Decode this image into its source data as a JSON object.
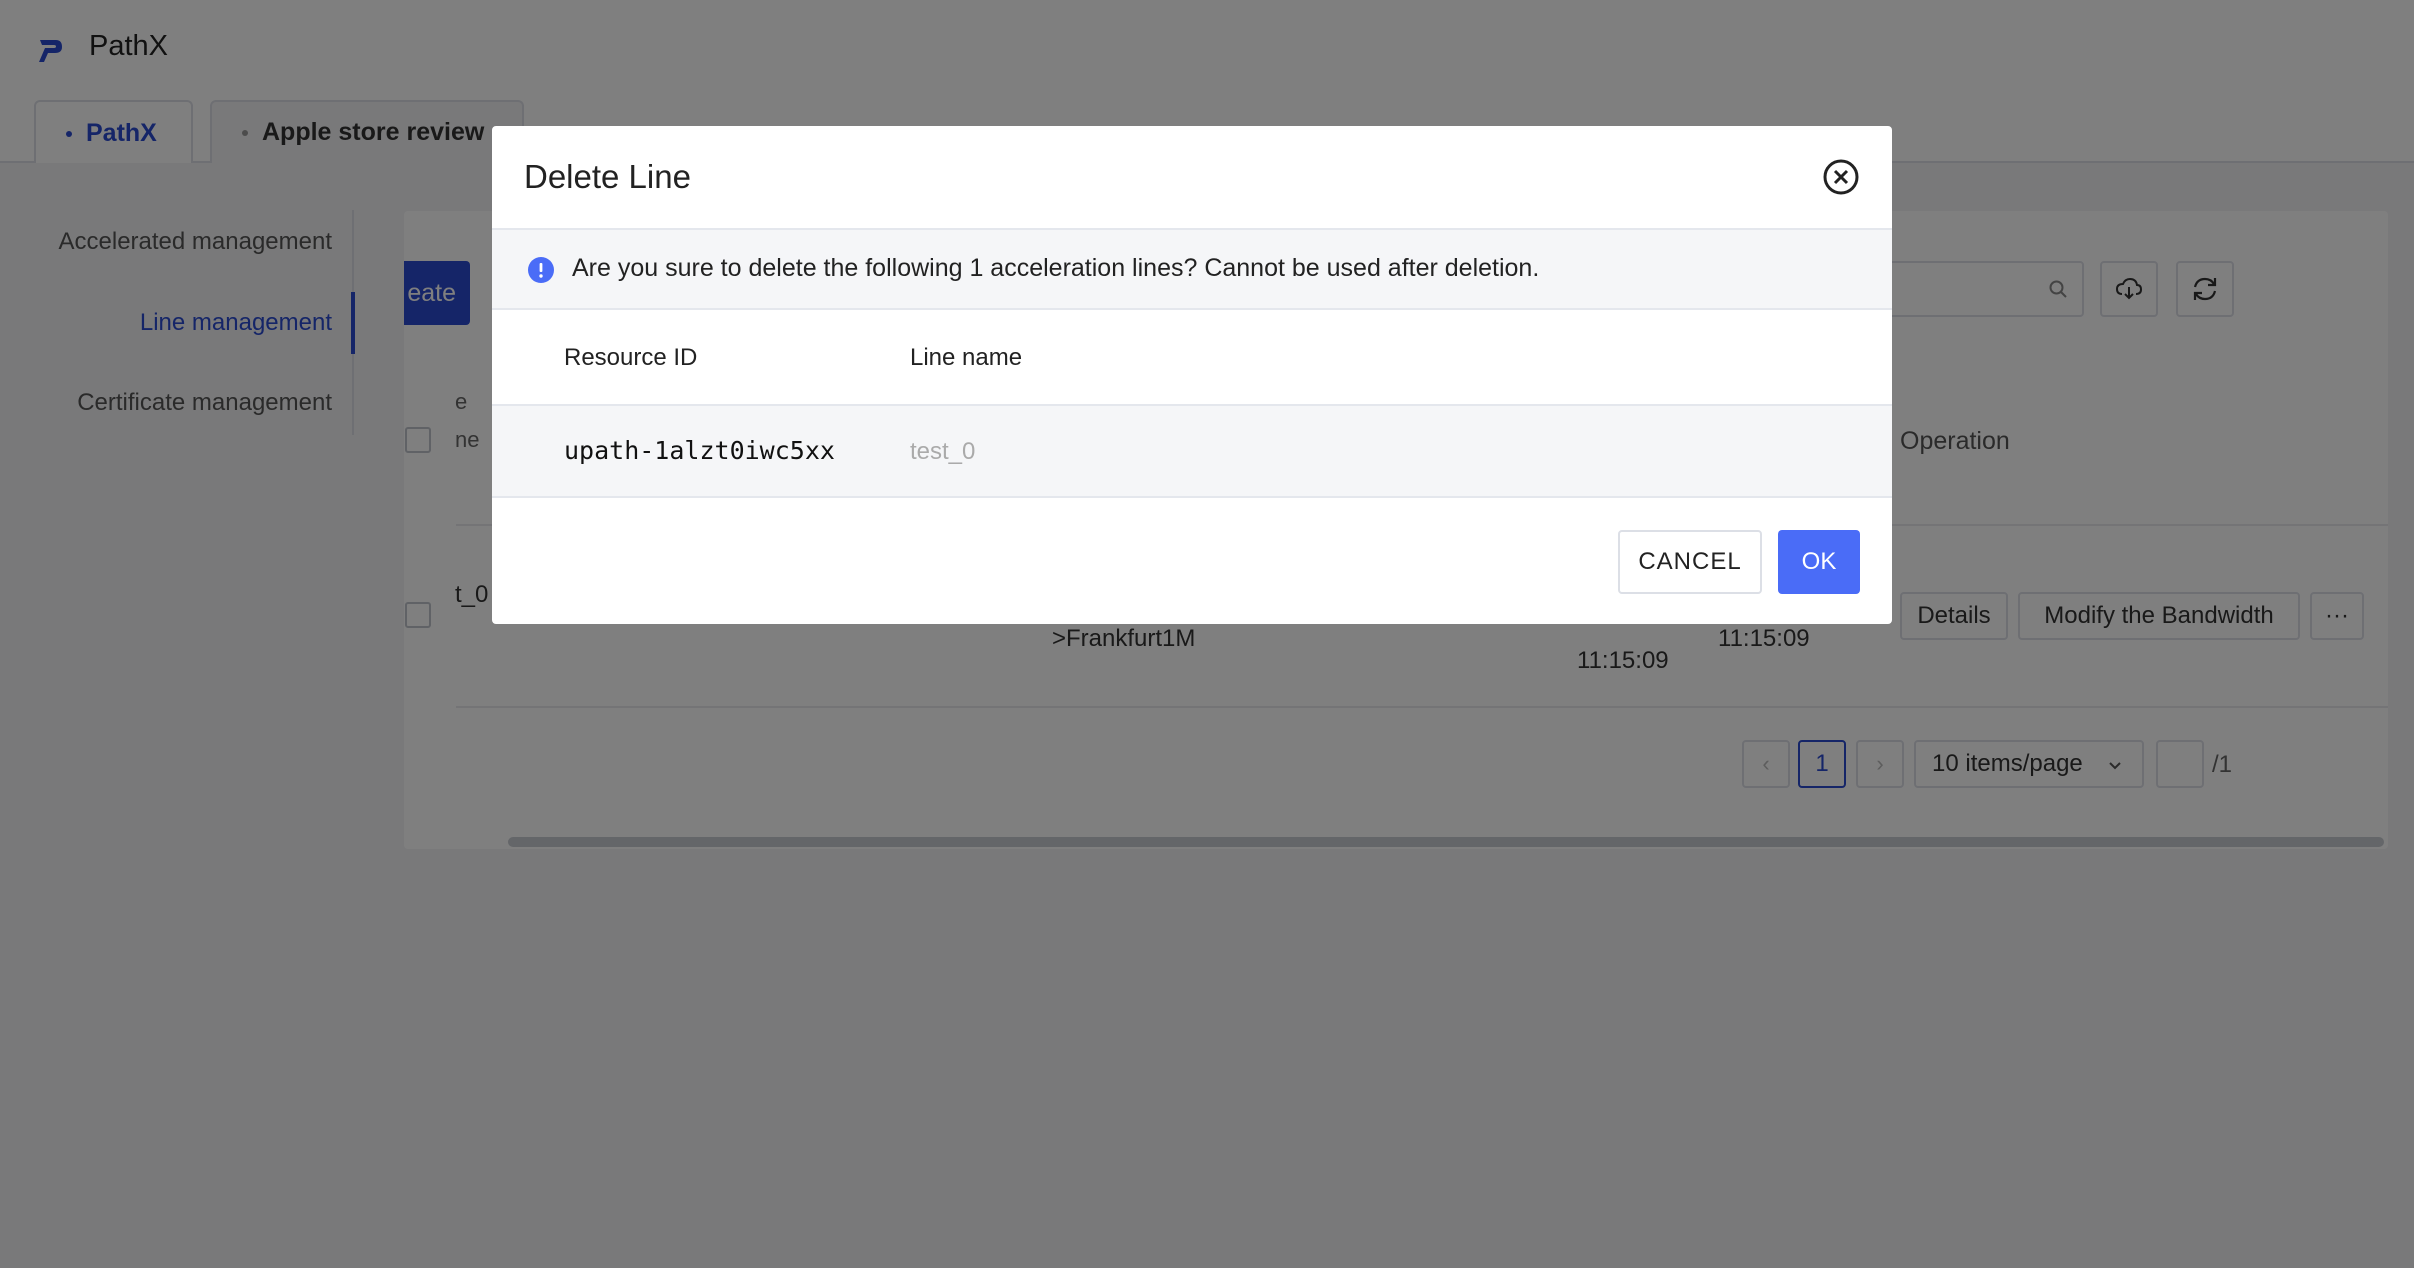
{
  "app": {
    "title": "PathX"
  },
  "tabs": [
    {
      "label": "PathX",
      "active": true
    },
    {
      "label": "Apple store review",
      "active": false
    }
  ],
  "sidebar": {
    "items": [
      {
        "label": "Accelerated management",
        "active": false
      },
      {
        "label": "Line management",
        "active": true
      },
      {
        "label": "Certificate management",
        "active": false
      }
    ]
  },
  "toolbar": {
    "create_label_fragment": "eate"
  },
  "table": {
    "header_fragments": [
      "e",
      "ne"
    ],
    "operation_header": "Operation",
    "row": {
      "name_fragment": "t_0",
      "route_fragment": ">Frankfurt1M",
      "created_time": "11:15:09",
      "updated_time": "11:15:09",
      "actions": {
        "details": "Details",
        "modify_bandwidth": "Modify the Bandwidth",
        "more": "···"
      }
    }
  },
  "pagination": {
    "prev": "‹",
    "current_page": "1",
    "next": "›",
    "page_size": "10 items/page",
    "total_pages": "/1"
  },
  "modal": {
    "title": "Delete Line",
    "alert_text": "Are you sure to delete the following 1 acceleration lines? Cannot be used after deletion.",
    "columns": {
      "resource_id": "Resource ID",
      "line_name": "Line name"
    },
    "rows": [
      {
        "resource_id": "upath-1alzt0iwc5xx",
        "line_name": "test_0"
      }
    ],
    "cancel_label": "CANCEL",
    "ok_label": "OK"
  },
  "colors": {
    "primary": "#2b4bd1",
    "ok_button": "#4a6cf7",
    "overlay": "rgba(0,0,0,0.5)"
  }
}
